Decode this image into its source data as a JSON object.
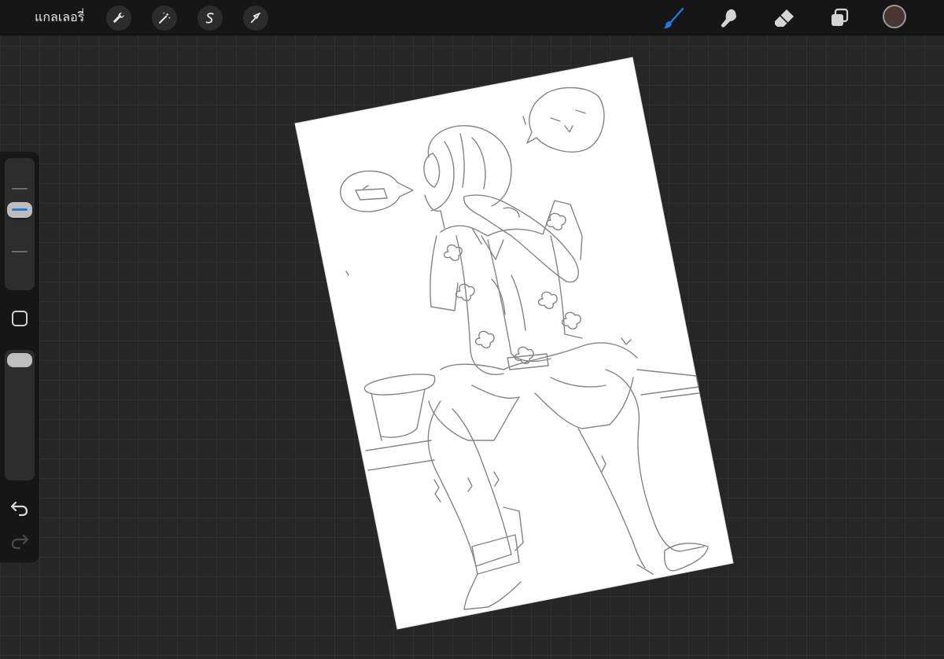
{
  "app": {
    "gallery_label": "แกลเลอรี่"
  },
  "toolbar": {
    "left_tools": [
      {
        "name": "actions",
        "icon": "wrench-icon"
      },
      {
        "name": "adjustments",
        "icon": "magic-wand-icon"
      },
      {
        "name": "selection",
        "icon": "selection-s-icon"
      },
      {
        "name": "transform",
        "icon": "arrow-cursor-icon"
      }
    ],
    "right_tools": [
      {
        "name": "brush",
        "icon": "brush-icon",
        "active": true
      },
      {
        "name": "smudge",
        "icon": "smudge-icon",
        "active": false
      },
      {
        "name": "eraser",
        "icon": "eraser-icon",
        "active": false
      },
      {
        "name": "layers",
        "icon": "layers-icon",
        "active": false
      }
    ],
    "current_color": "#4a3530",
    "accent_color": "#1f7ae0"
  },
  "sidebar": {
    "brush_size_level": 0.55,
    "brush_opacity_level": 1.0
  }
}
